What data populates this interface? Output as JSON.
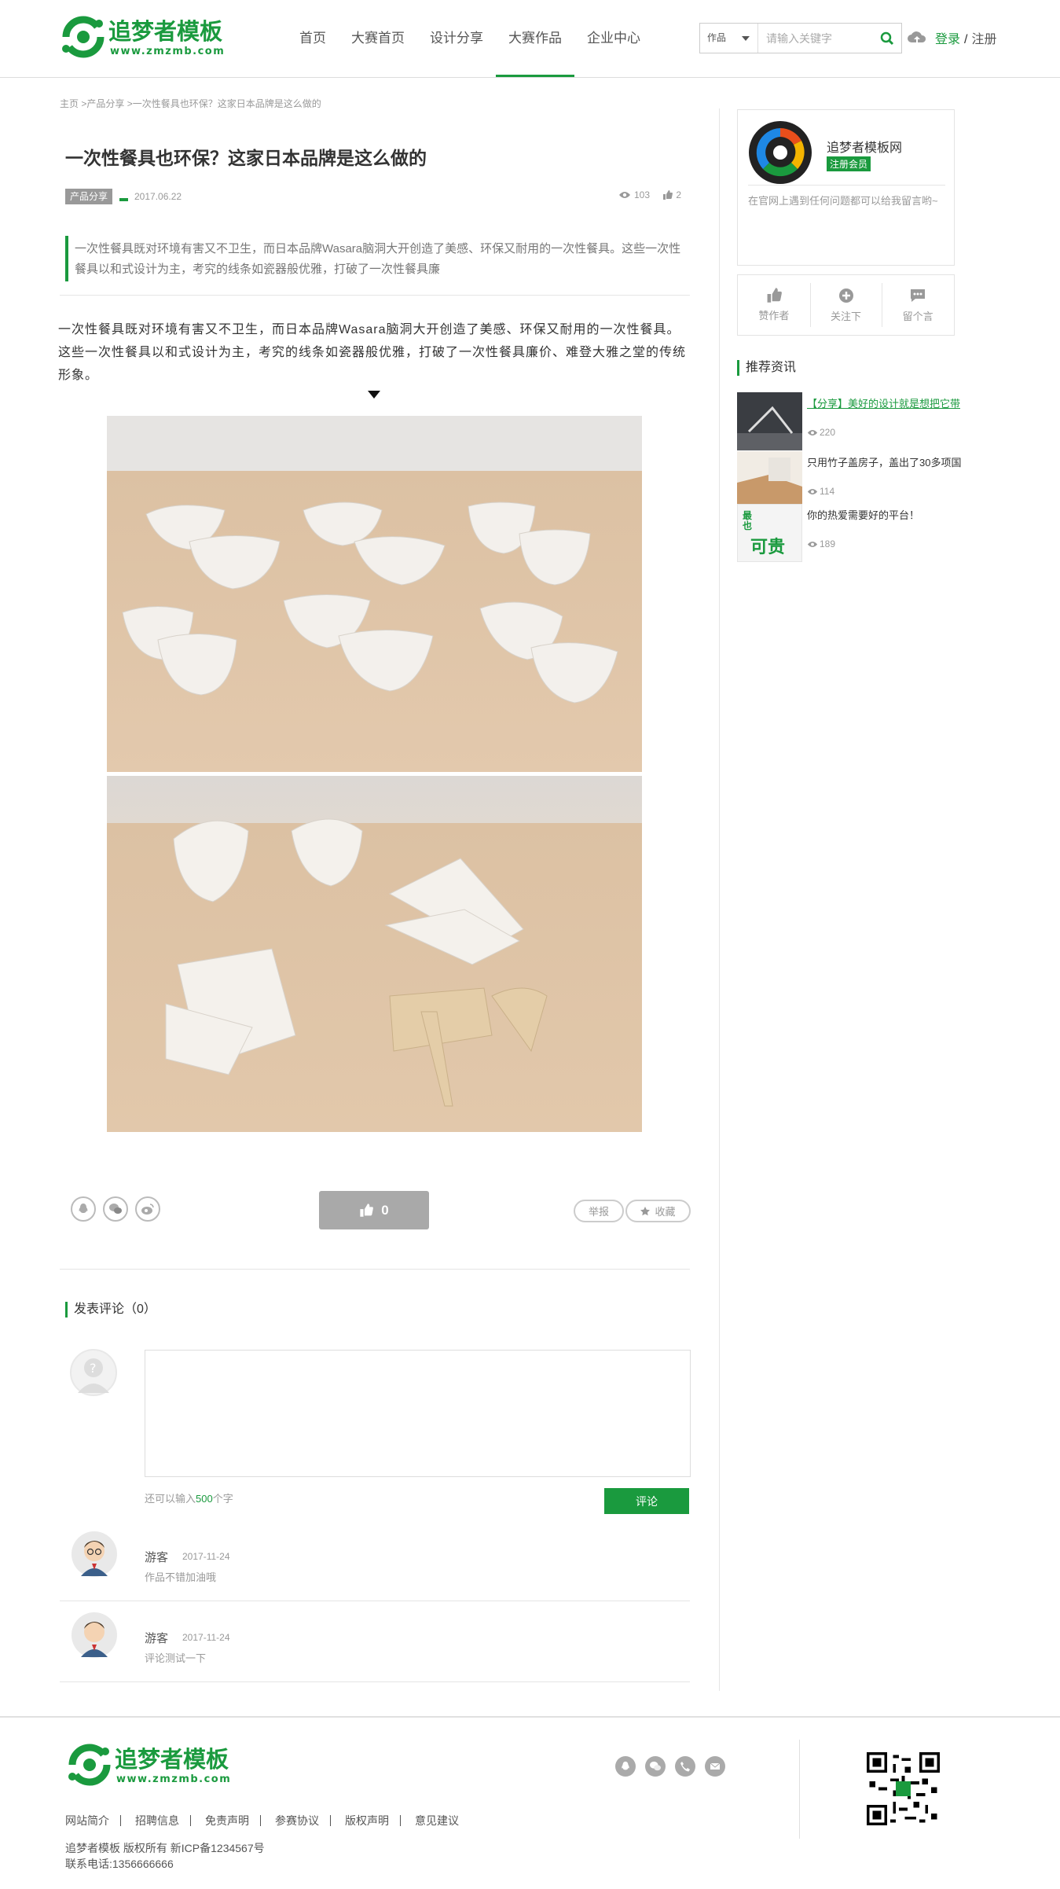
{
  "header": {
    "logo_title": "追梦者模板",
    "logo_url": "www.zmzmb.com",
    "nav": [
      "首页",
      "大赛首页",
      "设计分享",
      "大赛作品",
      "企业中心"
    ],
    "nav_active": 3,
    "search_category": "作品",
    "search_placeholder": "请输入关键字",
    "login": "登录",
    "auth_sep": "/",
    "register": "注册"
  },
  "breadcrumb": {
    "home": "主页",
    "sep1": " >",
    "cat": "产品分享",
    "sep2": " >",
    "current": "一次性餐具也环保？这家日本品牌是这么做的"
  },
  "article": {
    "title": "一次性餐具也环保？这家日本品牌是这么做的",
    "category": "产品分享",
    "date": "2017.06.22",
    "views": "103",
    "likes": "2",
    "summary": "一次性餐具既对环境有害又不卫生，而日本品牌Wasara脑洞大开创造了美感、环保又耐用的一次性餐具。这些一次性餐具以和式设计为主，考究的线条如瓷器般优雅，打破了一次性餐具廉",
    "body": "一次性餐具既对环境有害又不卫生，而日本品牌Wasara脑洞大开创造了美感、环保又耐用的一次性餐具。这些一次性餐具以和式设计为主，考究的线条如瓷器般优雅，打破了一次性餐具廉价、难登大雅之堂的传统形象。",
    "like_count": "0",
    "report": "举报",
    "favorite": "收藏"
  },
  "comments": {
    "title": "发表评论（0）",
    "remain_prefix": "还可以输入",
    "remain_num": "500",
    "remain_suffix": "个字",
    "submit": "评论",
    "items": [
      {
        "user": "游客",
        "date": "2017-11-24",
        "text": "作品不错加油哦"
      },
      {
        "user": "游客",
        "date": "2017-11-24",
        "text": "评论测试一下"
      }
    ]
  },
  "sidebar": {
    "author_name": "追梦者模板网",
    "author_tag": "注册会员",
    "author_desc": "在官网上遇到任何问题都可以给我留言哟~",
    "actions": [
      "赞作者",
      "关注下",
      "留个言"
    ],
    "rec_title": "推荐资讯",
    "rec": [
      {
        "title": "【分享】美好的设计就是想把它带",
        "views": "220"
      },
      {
        "title": "只用竹子盖房子，盖出了30多项国",
        "views": "114"
      },
      {
        "title": "你的热爱需要好的平台！",
        "views": "189"
      }
    ],
    "rec3_thumb_text": {
      "a": "最也",
      "b": "可贵"
    }
  },
  "footer": {
    "logo_title": "追梦者模板",
    "logo_url": "www.zmzmb.com",
    "links": [
      "网站简介",
      "招聘信息",
      "免责声明",
      "参赛协议",
      "版权声明",
      "意见建议"
    ],
    "copyright": "追梦者模板 版权所有 新ICP备1234567号",
    "phone": "联系电话:1356666666"
  },
  "colors": {
    "brand_green": "#1a9a3e",
    "gray_button": "#a9a9a9"
  }
}
